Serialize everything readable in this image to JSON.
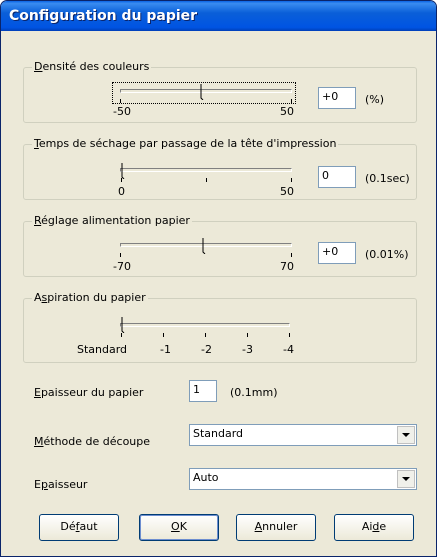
{
  "window": {
    "title": "Configuration du papier"
  },
  "density": {
    "legend_u": "D",
    "legend_rest": "ensité des couleurs",
    "min_label": "-50",
    "max_label": "50",
    "value": "+0",
    "unit": "(%)"
  },
  "drying": {
    "legend_u": "T",
    "legend_rest": "emps de séchage par passage de la tête d'impression",
    "min_label": "0",
    "max_label": "50",
    "value": "0",
    "unit": "(0.1sec)"
  },
  "feed": {
    "legend_u": "R",
    "legend_rest": "églage alimentation papier",
    "min_label": "-70",
    "max_label": "70",
    "value": "+0",
    "unit": "(0.01%)"
  },
  "suction": {
    "legend_pre": "A",
    "legend_u": "s",
    "legend_rest": "piration du papier",
    "labels": [
      "Standard",
      "-1",
      "-2",
      "-3",
      "-4"
    ]
  },
  "thickness": {
    "label_u": "E",
    "label_rest": "paisseur du papier",
    "value": "1",
    "unit": "(0.1mm)"
  },
  "cut_method": {
    "label_u": "M",
    "label_rest": "éthode de découpe",
    "value": "Standard"
  },
  "epaisseur": {
    "label_pre": "E",
    "label_u": "p",
    "label_rest": "aisseur",
    "value": "Auto"
  },
  "buttons": {
    "default_pre": "Dé",
    "default_u": "f",
    "default_rest": "aut",
    "ok_u": "O",
    "ok_rest": "K",
    "cancel_u": "A",
    "cancel_rest": "nnuler",
    "help_pre": "Ai",
    "help_u": "d",
    "help_rest": "e"
  }
}
